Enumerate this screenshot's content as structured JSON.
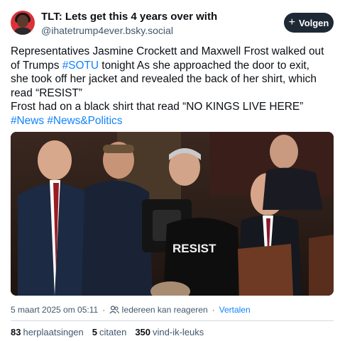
{
  "author": {
    "display_name": "TLT: Lets get this 4 years over with",
    "handle": "@ihatetrump4ever.bsky.social"
  },
  "follow_button": {
    "label": "Volgen",
    "icon": "plus-icon"
  },
  "post": {
    "lines": [
      [
        {
          "text": "Representatives Jasmine Crockett and Maxwell Frost walked out",
          "link": false
        }
      ],
      [
        {
          "text": "of Trumps ",
          "link": false
        },
        {
          "text": "#SOTU",
          "link": true
        },
        {
          "text": " tonight As she approached the door to exit,",
          "link": false
        }
      ],
      [
        {
          "text": "she took off her jacket and revealed the back of her shirt, which",
          "link": false
        }
      ],
      [
        {
          "text": "read “RESIST”",
          "link": false
        }
      ],
      [
        {
          "text": "Frost had on a black shirt that read “NO KINGS LIVE HERE”",
          "link": false
        }
      ],
      [
        {
          "text": "#News",
          "link": true
        },
        {
          "text": " ",
          "link": false
        },
        {
          "text": "#News&Politics",
          "link": true
        }
      ]
    ]
  },
  "media": {
    "shirt_text": "RESIST"
  },
  "meta": {
    "timestamp": "5 maart 2025 om 05:11",
    "reply_setting": "Iedereen kan reageren",
    "translate_label": "Vertalen",
    "separator": "·"
  },
  "stats": [
    {
      "count": "83",
      "label": "herplaatsingen"
    },
    {
      "count": "5",
      "label": "citaten"
    },
    {
      "count": "350",
      "label": "vind-ik-leuks"
    }
  ],
  "colors": {
    "link": "#1083fe",
    "button_bg": "#1e2936",
    "muted": "#42576c"
  }
}
